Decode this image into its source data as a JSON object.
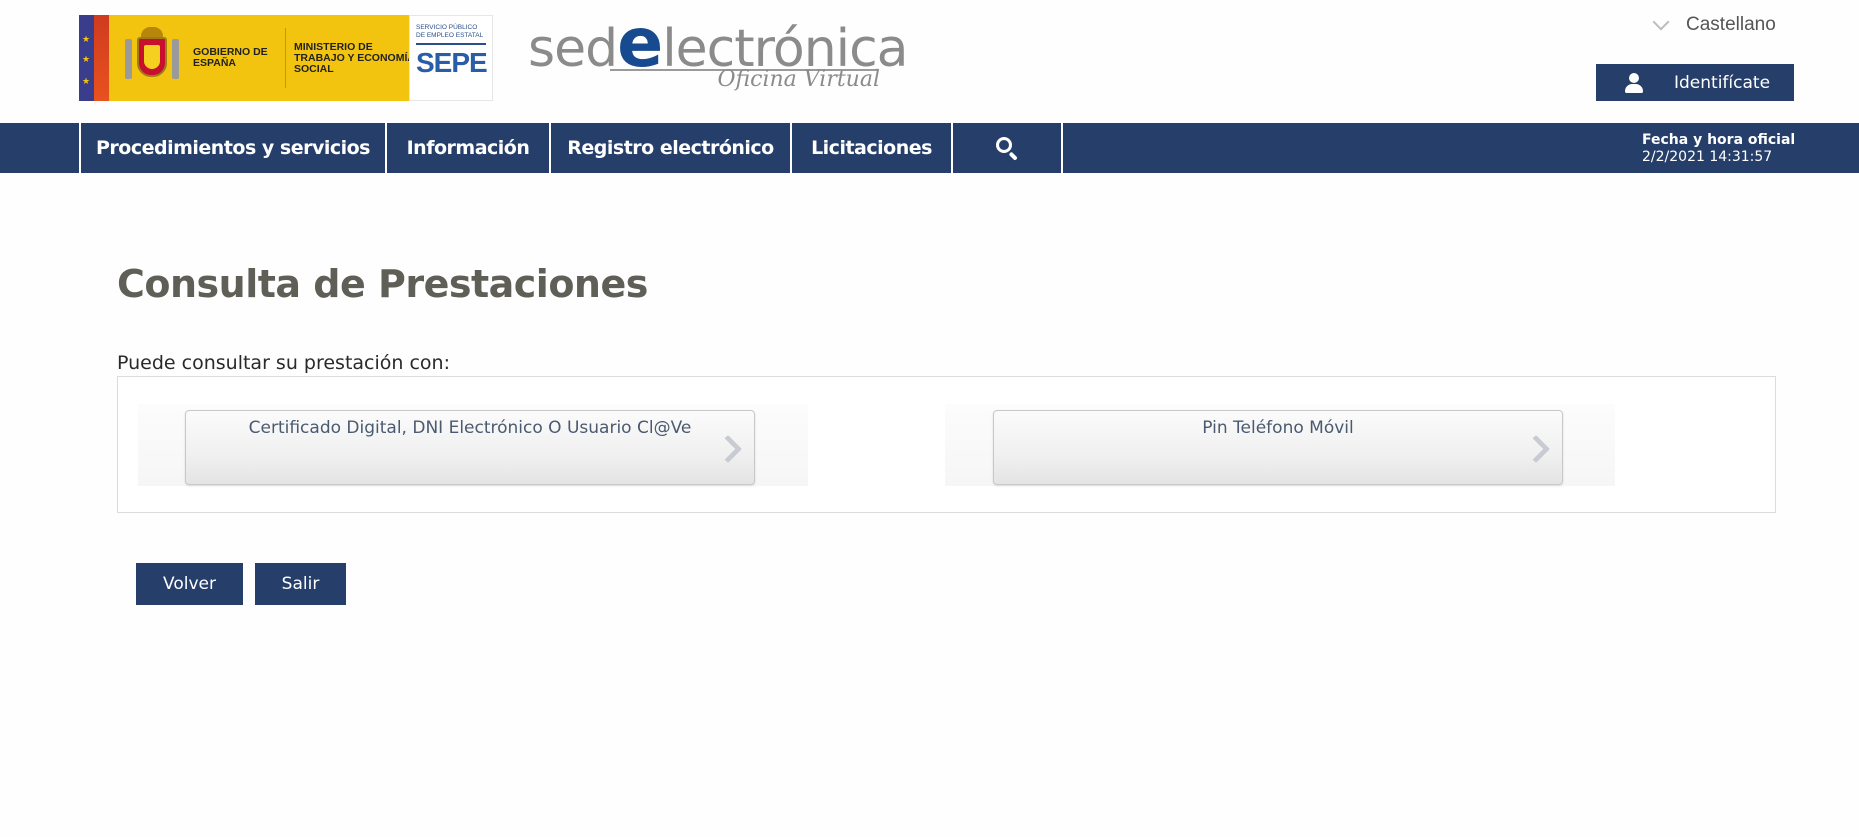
{
  "header": {
    "gov_logo_text": "GOBIERNO DE ESPAÑA",
    "ministry_text": "MINISTERIO DE TRABAJO Y ECONOMÍA SOCIAL",
    "sepe_small": "SERVICIO PÚBLICO DE EMPLEO ESTATAL",
    "sepe_big": "SEPE",
    "sede_prefix": "sed",
    "sede_e": "e",
    "sede_suffix": "lectrónica",
    "sede_sub": "Oficina Virtual",
    "language": "Castellano",
    "login_label": "Identifícate"
  },
  "nav": {
    "items": [
      {
        "label": "Procedimientos y servicios"
      },
      {
        "label": "Información"
      },
      {
        "label": "Registro electrónico"
      },
      {
        "label": "Licitaciones"
      }
    ],
    "search_icon": "search-icon",
    "official_time_label": "Fecha y hora oficial",
    "official_time_value": "2/2/2021 14:31:57"
  },
  "main": {
    "title": "Consulta de Prestaciones",
    "intro": "Puede consultar su prestación con:",
    "options": [
      {
        "label": "Certificado Digital, DNI Electrónico O Usuario Cl@Ve"
      },
      {
        "label": "Pin Teléfono Móvil"
      }
    ],
    "back_label": "Volver",
    "exit_label": "Salir"
  },
  "colors": {
    "primary": "#263f6a",
    "title_gray": "#5f5f57",
    "gov_yellow": "#f2c40f"
  }
}
